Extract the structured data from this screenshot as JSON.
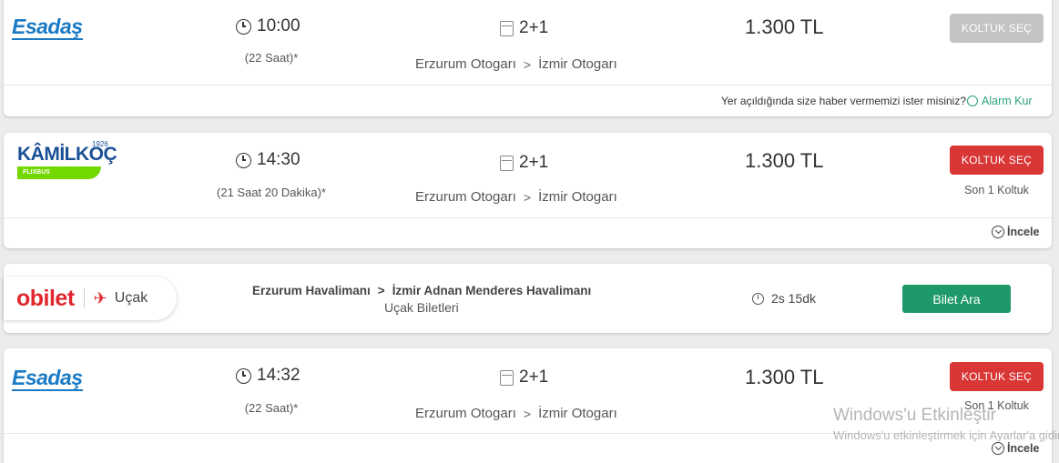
{
  "results": [
    {
      "logo": "Esadaş",
      "time": "10:00",
      "duration": "(22 Saat)*",
      "seating": "2+1",
      "from": "Erzurum Otogarı",
      "to": "İzmir Otogarı",
      "separator": ">",
      "price": "1.300 TL",
      "button_label": "KOLTUK SEÇ",
      "button_state": "disabled",
      "alarm_question": "Yer açıldığında size haber vermemizi ister misiniz?",
      "alarm_link": "Alarm Kur"
    },
    {
      "logo": "KÂMİLKOÇ",
      "logo_year": "1926",
      "logo_sub": "FLIXBUS",
      "time": "14:30",
      "duration": "(21 Saat 20 Dakika)*",
      "seating": "2+1",
      "from": "Erzurum Otogarı",
      "to": "İzmir Otogarı",
      "separator": ">",
      "price": "1.300 TL",
      "button_label": "KOLTUK SEÇ",
      "button_state": "active",
      "last_seat": "Son 1 Koltuk",
      "details_link": "İncele"
    },
    {
      "logo": "Esadaş",
      "time": "14:32",
      "duration": "(22 Saat)*",
      "seating": "2+1",
      "from": "Erzurum Otogarı",
      "to": "İzmir Otogarı",
      "separator": ">",
      "price": "1.300 TL",
      "button_label": "KOLTUK SEÇ",
      "button_state": "active",
      "last_seat": "Son 1 Koltuk",
      "details_link": "İncele"
    }
  ],
  "flight_promo": {
    "brand": "obilet",
    "mode": "Uçak",
    "from": "Erzurum Havalimanı",
    "separator": ">",
    "to": "İzmir Adnan Menderes Havalimanı",
    "subtitle": "Uçak Biletleri",
    "duration": "2s 15dk",
    "button_label": "Bilet Ara"
  },
  "watermark": {
    "line1": "Windows'u Etkinleştir",
    "line2": "Windows'u etkinleştirmek için Ayarlar'a gidin."
  },
  "colors": {
    "red_button": "#d93636",
    "gray_button": "#c4c4c4",
    "green_button": "#1e9a6a",
    "alarm_green": "#2aa37a",
    "esadas_blue": "#1a7ac4",
    "obilet_red": "#e0262e"
  }
}
